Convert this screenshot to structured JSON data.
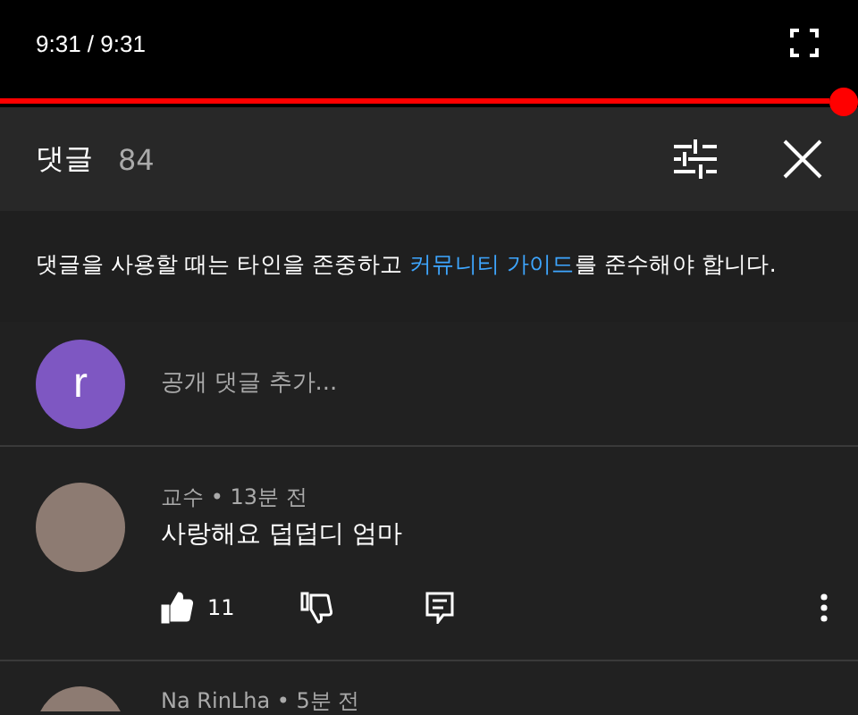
{
  "player": {
    "time": "9:31 / 9:31",
    "progress": {
      "level": 1.0
    }
  },
  "header": {
    "title": "댓글",
    "count": "84"
  },
  "guidelines": "댓글을 사용할 때는 타인을 존중하고 **커뮤니티 가이드**를 준수해야 합니다.",
  "compose": {
    "avatar_letter": "r",
    "placeholder": "공개 댓글 추가..."
  },
  "comments": [
    {
      "author": "교수 • 13분 전",
      "text": "사랑해요 덥덥디 엄마",
      "likes": "11",
      "liked": true
    },
    {
      "author": "Na RinLha • 5분 전"
    }
  ]
}
